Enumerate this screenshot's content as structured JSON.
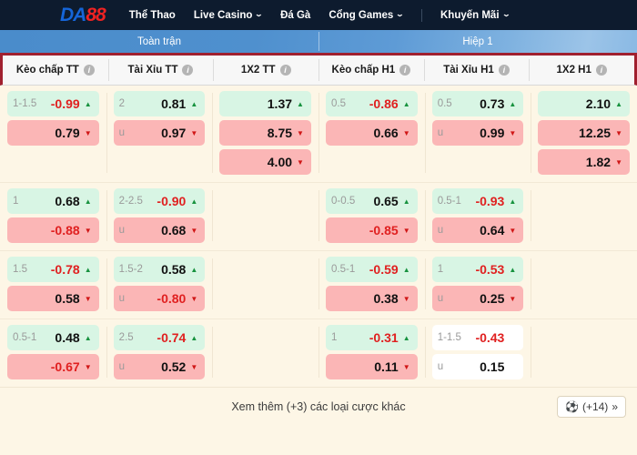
{
  "header": {
    "logo": {
      "part1": "DA",
      "part2": "88"
    },
    "nav": [
      {
        "label": "Thể Thao",
        "caret": false,
        "sep_after": false
      },
      {
        "label": "Live Casino",
        "caret": true,
        "sep_after": false
      },
      {
        "label": "Đá Gà",
        "caret": false,
        "sep_after": false
      },
      {
        "label": "Cổng Games",
        "caret": true,
        "sep_after": true
      },
      {
        "label": "Khuyến Mãi",
        "caret": true,
        "sep_after": false
      }
    ],
    "caret_glyph": "⌄"
  },
  "period_tabs": [
    {
      "label": "Toàn trận",
      "active": true
    },
    {
      "label": "Hiệp 1",
      "active": false
    }
  ],
  "columns": [
    {
      "label": "Kèo chấp TT",
      "info": "i"
    },
    {
      "label": "Tài Xỉu TT",
      "info": "i"
    },
    {
      "label": "1X2 TT",
      "info": "i"
    },
    {
      "label": "Kèo chấp H1",
      "info": "i"
    },
    {
      "label": "Tài Xỉu H1",
      "info": "i"
    },
    {
      "label": "1X2 H1",
      "info": "i"
    }
  ],
  "arrows": {
    "up": "▲",
    "down": "▼"
  },
  "colors": {
    "brand_blue": "#1565d8",
    "brand_red": "#ef2222",
    "tab_blue": "#4a8ccb",
    "accent_border": "#a0202f",
    "cell_up": "#d8f5e4",
    "cell_down": "#fbb6b6",
    "cell_neutral": "#ffffff",
    "background": "#fdf6e6",
    "negative_text": "#e02020"
  },
  "rows": [
    {
      "cells": [
        [
          {
            "handicap": "1-1.5",
            "odds": "-0.99",
            "state": "up"
          },
          {
            "handicap": "",
            "odds": "0.79",
            "state": "down"
          }
        ],
        [
          {
            "handicap": "2",
            "odds": "0.81",
            "state": "up"
          },
          {
            "handicap": "u",
            "odds": "0.97",
            "state": "down"
          }
        ],
        [
          {
            "handicap": "",
            "odds": "1.37",
            "state": "up"
          },
          {
            "handicap": "",
            "odds": "8.75",
            "state": "down"
          },
          {
            "handicap": "",
            "odds": "4.00",
            "state": "down"
          }
        ],
        [
          {
            "handicap": "0.5",
            "odds": "-0.86",
            "state": "up"
          },
          {
            "handicap": "",
            "odds": "0.66",
            "state": "down"
          }
        ],
        [
          {
            "handicap": "0.5",
            "odds": "0.73",
            "state": "up"
          },
          {
            "handicap": "u",
            "odds": "0.99",
            "state": "down"
          }
        ],
        [
          {
            "handicap": "",
            "odds": "2.10",
            "state": "up"
          },
          {
            "handicap": "",
            "odds": "12.25",
            "state": "down"
          },
          {
            "handicap": "",
            "odds": "1.82",
            "state": "down"
          }
        ]
      ]
    },
    {
      "cells": [
        [
          {
            "handicap": "1",
            "odds": "0.68",
            "state": "up"
          },
          {
            "handicap": "",
            "odds": "-0.88",
            "state": "down"
          }
        ],
        [
          {
            "handicap": "2-2.5",
            "odds": "-0.90",
            "state": "up"
          },
          {
            "handicap": "u",
            "odds": "0.68",
            "state": "down"
          }
        ],
        [],
        [
          {
            "handicap": "0-0.5",
            "odds": "0.65",
            "state": "up"
          },
          {
            "handicap": "",
            "odds": "-0.85",
            "state": "down"
          }
        ],
        [
          {
            "handicap": "0.5-1",
            "odds": "-0.93",
            "state": "up"
          },
          {
            "handicap": "u",
            "odds": "0.64",
            "state": "down"
          }
        ],
        []
      ]
    },
    {
      "cells": [
        [
          {
            "handicap": "1.5",
            "odds": "-0.78",
            "state": "up"
          },
          {
            "handicap": "",
            "odds": "0.58",
            "state": "down"
          }
        ],
        [
          {
            "handicap": "1.5-2",
            "odds": "0.58",
            "state": "up"
          },
          {
            "handicap": "u",
            "odds": "-0.80",
            "state": "down"
          }
        ],
        [],
        [
          {
            "handicap": "0.5-1",
            "odds": "-0.59",
            "state": "up"
          },
          {
            "handicap": "",
            "odds": "0.38",
            "state": "down"
          }
        ],
        [
          {
            "handicap": "1",
            "odds": "-0.53",
            "state": "up"
          },
          {
            "handicap": "u",
            "odds": "0.25",
            "state": "down"
          }
        ],
        []
      ]
    },
    {
      "cells": [
        [
          {
            "handicap": "0.5-1",
            "odds": "0.48",
            "state": "up"
          },
          {
            "handicap": "",
            "odds": "-0.67",
            "state": "down"
          }
        ],
        [
          {
            "handicap": "2.5",
            "odds": "-0.74",
            "state": "up"
          },
          {
            "handicap": "u",
            "odds": "0.52",
            "state": "down"
          }
        ],
        [],
        [
          {
            "handicap": "1",
            "odds": "-0.31",
            "state": "up"
          },
          {
            "handicap": "",
            "odds": "0.11",
            "state": "down"
          }
        ],
        [
          {
            "handicap": "1-1.5",
            "odds": "-0.43",
            "state": "neutral"
          },
          {
            "handicap": "u",
            "odds": "0.15",
            "state": "neutral"
          }
        ],
        []
      ]
    }
  ],
  "footer": {
    "more_text": "Xem thêm (+3) các loại cược khác",
    "badge_count": "(+14)",
    "ball_icon": "⚽",
    "chevron": "»"
  }
}
